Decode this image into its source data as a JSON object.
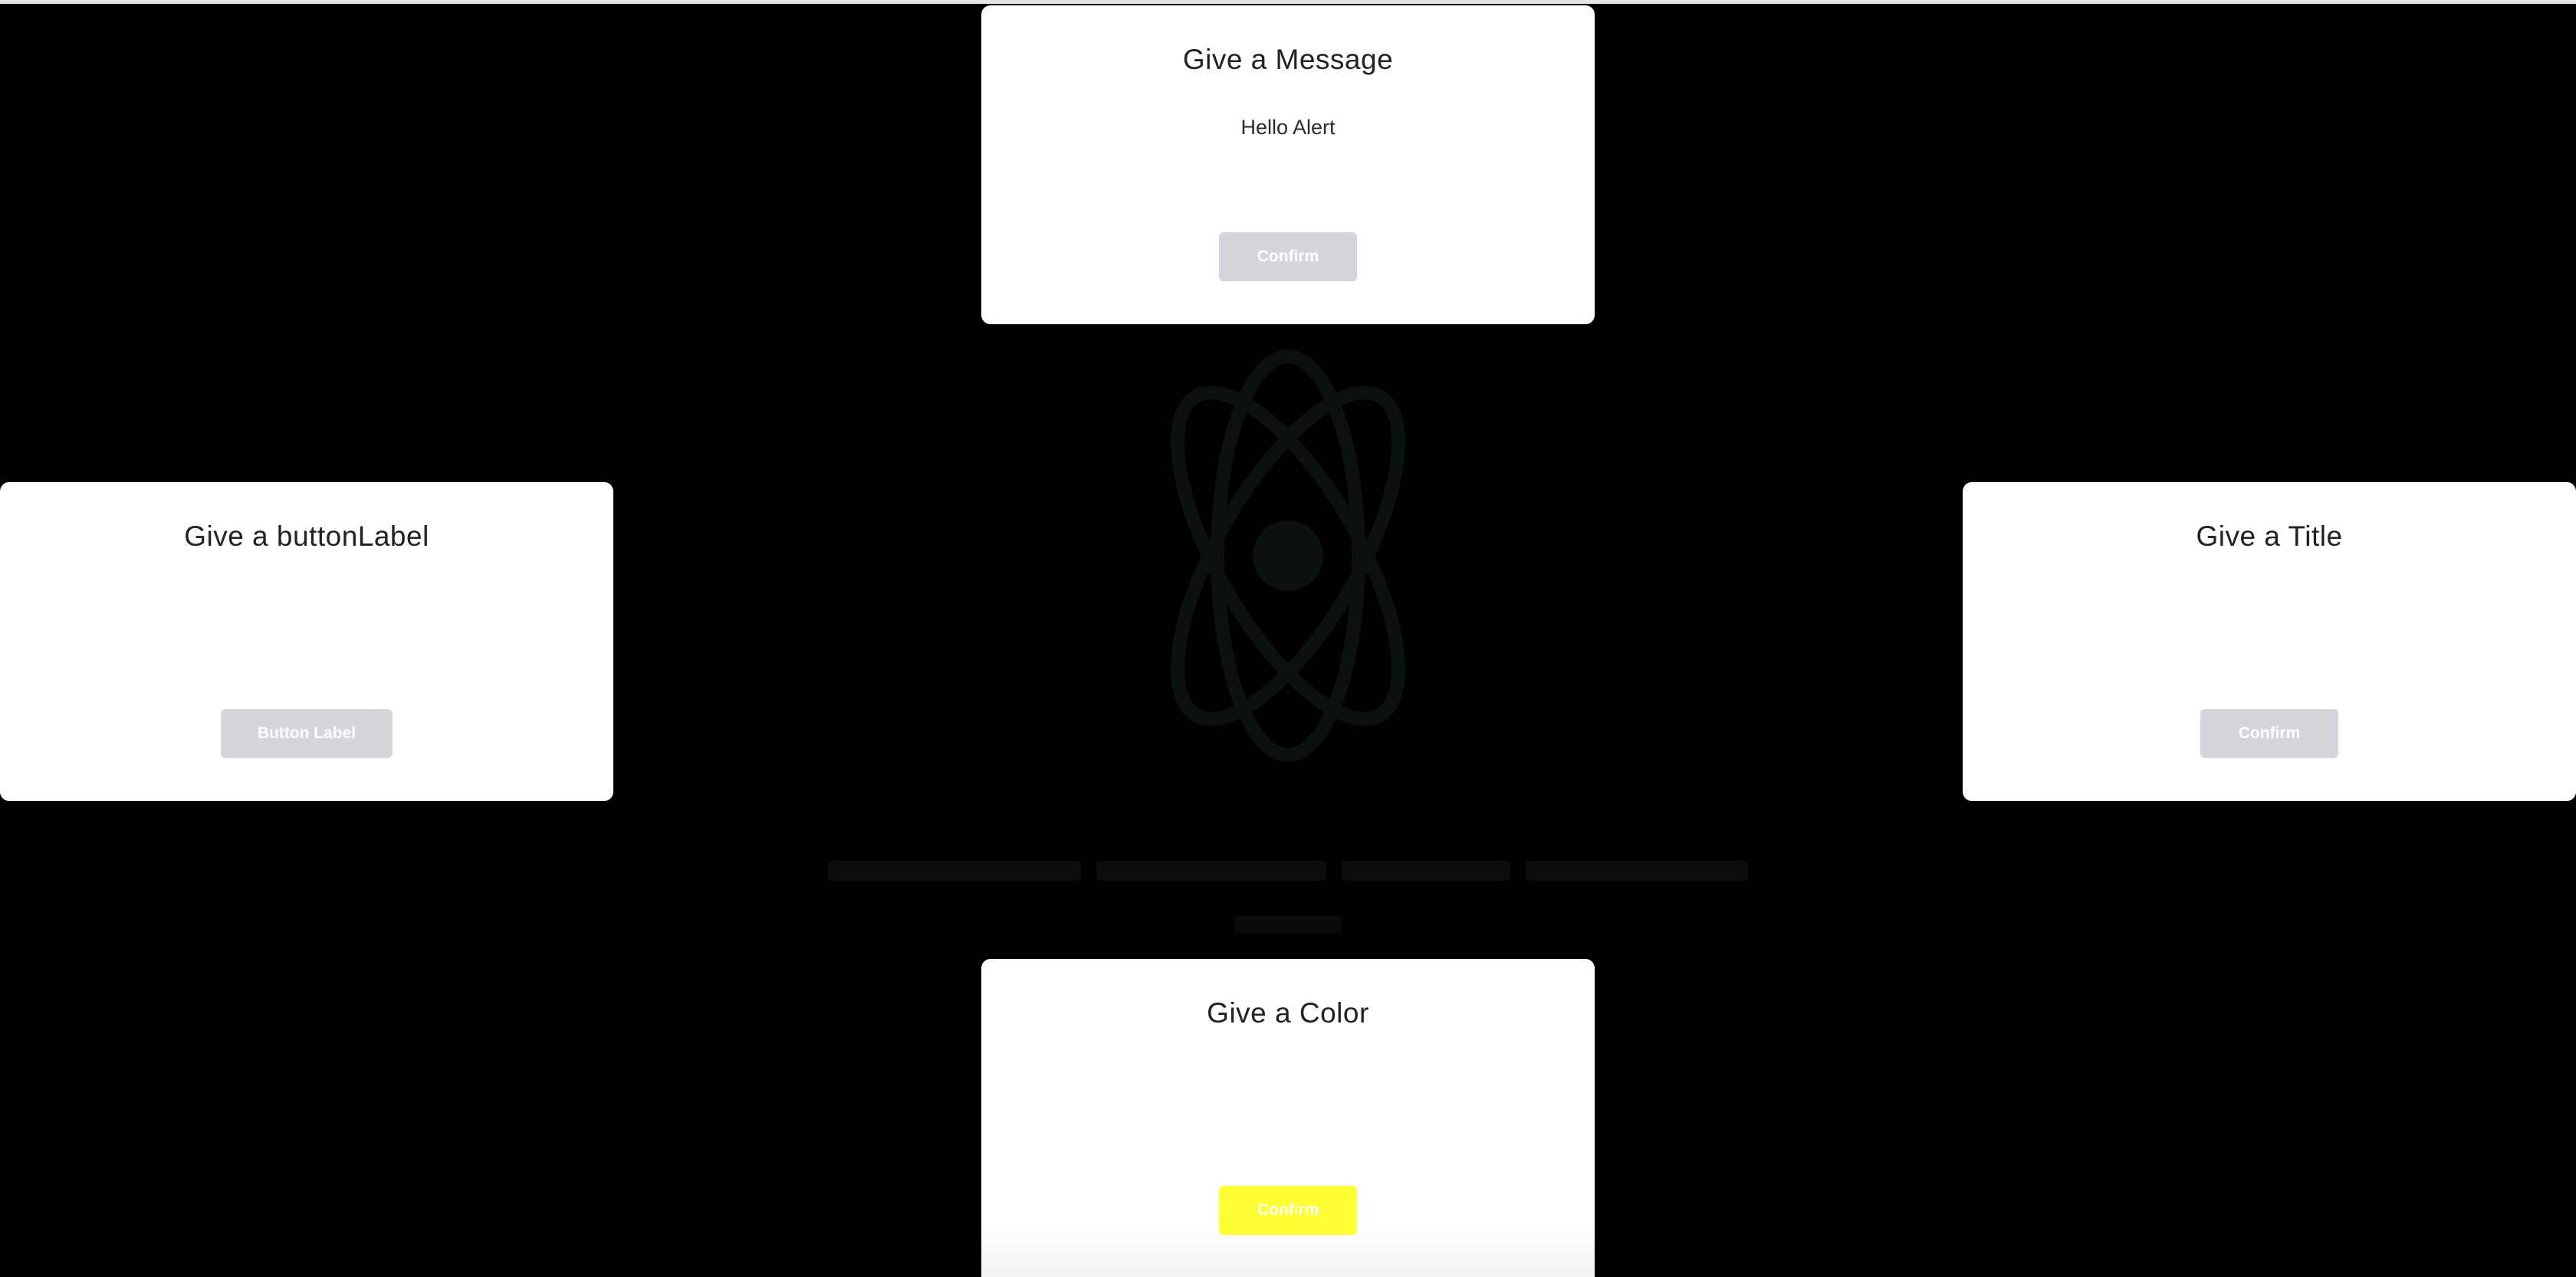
{
  "colors": {
    "background": "#000000",
    "card_background": "#ffffff",
    "button_default": "#d4d6db",
    "button_color_variant": "#ffff33",
    "title_text": "#222222",
    "backdrop_logo": "#0b120e"
  },
  "backdrop": {
    "logo_icon": "react-atom-icon"
  },
  "alerts": {
    "top": {
      "title": "Give a Message",
      "message": "Hello Alert",
      "button_label": "Confirm"
    },
    "left": {
      "title": "Give a buttonLabel",
      "message": "",
      "button_label": "Button Label"
    },
    "right": {
      "title": "Give a Title",
      "message": "",
      "button_label": "Confirm"
    },
    "bottom": {
      "title": "Give a Color",
      "message": "",
      "button_label": "Confirm",
      "button_color": "#ffff33"
    }
  }
}
